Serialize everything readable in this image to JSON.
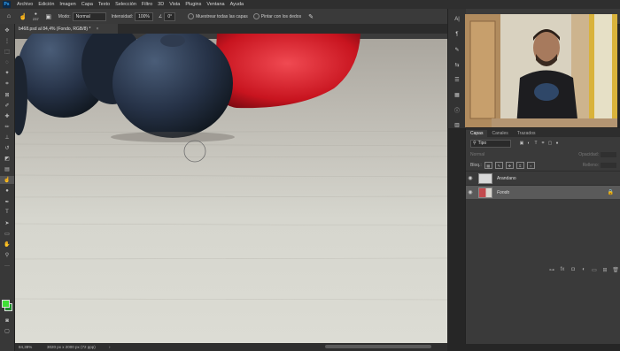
{
  "menu": [
    "Archivo",
    "Edición",
    "Imagen",
    "Capa",
    "Texto",
    "Selección",
    "Filtro",
    "3D",
    "Vista",
    "Plugins",
    "Ventana",
    "Ayuda"
  ],
  "app_logo": "Ps",
  "options": {
    "brush_size": "237",
    "mode_label": "Modo:",
    "mode_value": "Normal",
    "intensity_label": "Intensidad:",
    "intensity_value": "100%",
    "angle_value": "0°",
    "sample_all_label": "Muestrear todas las capas",
    "finger_paint_label": "Pintar con los dedos"
  },
  "document": {
    "tab_title": "b468.psd al 84,4% (Fondo, RGB/8) *",
    "zoom": "84,38%",
    "info": "3020 px x 2000 px (72 ppp)",
    "arrow": "›"
  },
  "layers_panel": {
    "tabs": [
      "Capas",
      "Canales",
      "Trazados"
    ],
    "filter_label": "Tipo",
    "blend_mode": "Normal",
    "opacity_label": "Opacidad:",
    "lock_label": "Bloq.:",
    "fill_label": "Relleno:",
    "layers": [
      {
        "name": "Arandano",
        "selected": false,
        "locked": false
      },
      {
        "name": "Fondo",
        "selected": true,
        "locked": true
      }
    ]
  },
  "colors": {
    "foreground": "#3fe035",
    "background": "#1e8c2a",
    "app_bg": "#262626",
    "panel_bg": "#3a3a3a"
  }
}
